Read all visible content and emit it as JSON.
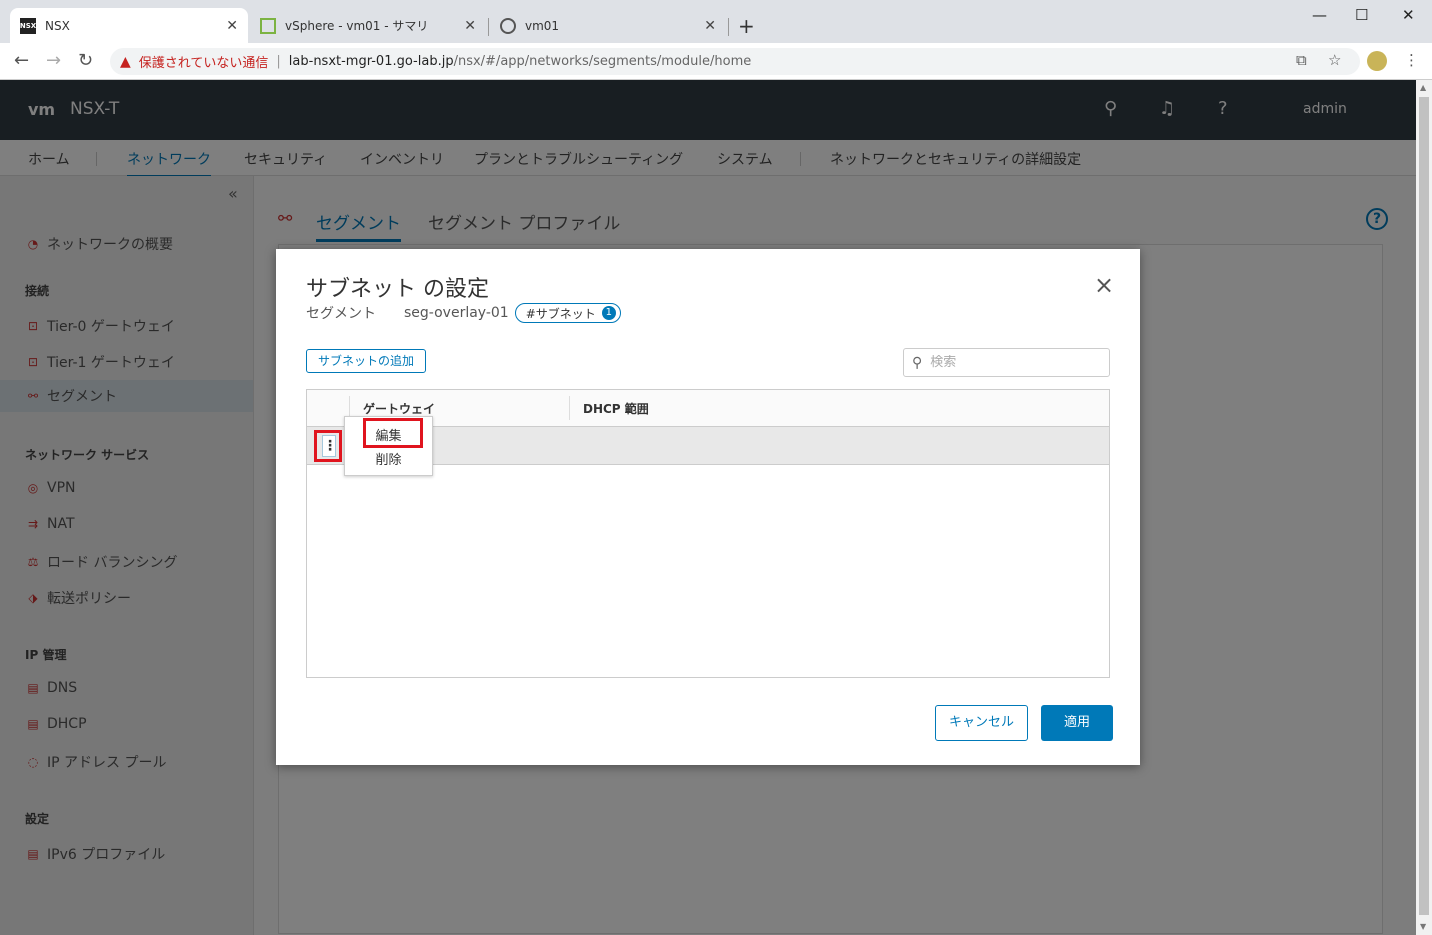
{
  "browser": {
    "tabs": [
      {
        "title": "NSX",
        "favicon": "NSX"
      },
      {
        "title": "vSphere - vm01 - サマリ"
      },
      {
        "title": "vm01"
      }
    ],
    "new_tab": "+",
    "window_controls": {
      "minimize": "—",
      "maximize": "☐",
      "close": "✕"
    },
    "nav": {
      "back": "←",
      "forward": "→",
      "reload": "↻"
    },
    "address": {
      "warning_icon": "▲",
      "warning_text": "保護されていない通信",
      "separator": "|",
      "host": "lab-nsxt-mgr-01.go-lab.jp",
      "path": "/nsx/#/app/networks/segments/module/home"
    }
  },
  "app": {
    "logo": "vm",
    "brand": "NSX-T",
    "user": "admin",
    "topnav": [
      "ホーム",
      "ネットワーク",
      "セキュリティ",
      "インベントリ",
      "プランとトラブルシューティング",
      "システム",
      "ネットワークとセキュリティの詳細設定"
    ],
    "sidebar": {
      "collapse": "«",
      "overview": "ネットワークの概要",
      "sec_connect": "接続",
      "tier0": "Tier-0 ゲートウェイ",
      "tier1": "Tier-1 ゲートウェイ",
      "segment": "セグメント",
      "sec_services": "ネットワーク サービス",
      "vpn": "VPN",
      "nat": "NAT",
      "lb": "ロード バランシング",
      "fwd": "転送ポリシー",
      "sec_ip": "IP 管理",
      "dns": "DNS",
      "dhcp": "DHCP",
      "ippool": "IP アドレス プール",
      "sec_settings": "設定",
      "ipv6": "IPv6 プロファイル"
    },
    "main_tabs": [
      "セグメント",
      "セグメント プロファイル"
    ],
    "help": "?"
  },
  "modal": {
    "title": "サブネット の設定",
    "close": "×",
    "segment_label": "セグメント",
    "segment_name": "seg-overlay-01",
    "badge_label": "#サブネット",
    "badge_count": "1",
    "add_button": "サブネットの追加",
    "search_placeholder": "検索",
    "columns": [
      "ゲートウェイ",
      "DHCP 範囲"
    ],
    "kebab": "⋮",
    "menu": [
      "編集",
      "削除"
    ],
    "cancel": "キャンセル",
    "apply": "適用"
  }
}
